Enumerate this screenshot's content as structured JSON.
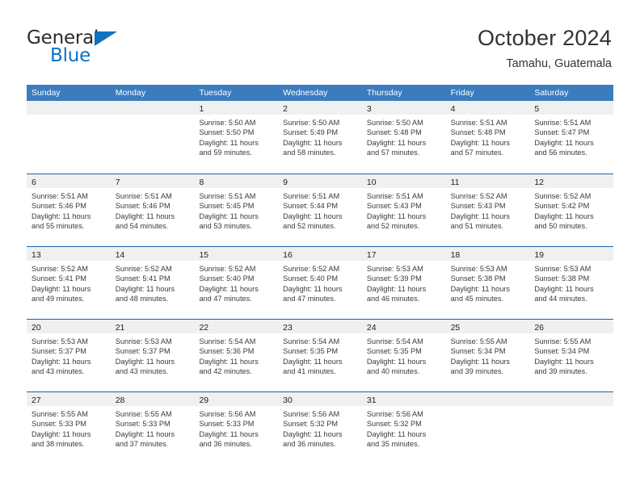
{
  "brand": {
    "name_part1": "General",
    "name_part2": "Blue"
  },
  "header": {
    "title": "October 2024",
    "subtitle": "Tamahu, Guatemala"
  },
  "colors": {
    "header_blue": "#3b7cbe",
    "separator_blue": "#1a62a8",
    "brand_blue": "#0a71c5",
    "daynum_band": "#f0f0f0"
  },
  "weekdays": [
    "Sunday",
    "Monday",
    "Tuesday",
    "Wednesday",
    "Thursday",
    "Friday",
    "Saturday"
  ],
  "weeks": [
    [
      {
        "empty": true
      },
      {
        "empty": true
      },
      {
        "day": "1",
        "sunrise": "Sunrise: 5:50 AM",
        "sunset": "Sunset: 5:50 PM",
        "daylight1": "Daylight: 11 hours",
        "daylight2": "and 59 minutes."
      },
      {
        "day": "2",
        "sunrise": "Sunrise: 5:50 AM",
        "sunset": "Sunset: 5:49 PM",
        "daylight1": "Daylight: 11 hours",
        "daylight2": "and 58 minutes."
      },
      {
        "day": "3",
        "sunrise": "Sunrise: 5:50 AM",
        "sunset": "Sunset: 5:48 PM",
        "daylight1": "Daylight: 11 hours",
        "daylight2": "and 57 minutes."
      },
      {
        "day": "4",
        "sunrise": "Sunrise: 5:51 AM",
        "sunset": "Sunset: 5:48 PM",
        "daylight1": "Daylight: 11 hours",
        "daylight2": "and 57 minutes."
      },
      {
        "day": "5",
        "sunrise": "Sunrise: 5:51 AM",
        "sunset": "Sunset: 5:47 PM",
        "daylight1": "Daylight: 11 hours",
        "daylight2": "and 56 minutes."
      }
    ],
    [
      {
        "day": "6",
        "sunrise": "Sunrise: 5:51 AM",
        "sunset": "Sunset: 5:46 PM",
        "daylight1": "Daylight: 11 hours",
        "daylight2": "and 55 minutes."
      },
      {
        "day": "7",
        "sunrise": "Sunrise: 5:51 AM",
        "sunset": "Sunset: 5:46 PM",
        "daylight1": "Daylight: 11 hours",
        "daylight2": "and 54 minutes."
      },
      {
        "day": "8",
        "sunrise": "Sunrise: 5:51 AM",
        "sunset": "Sunset: 5:45 PM",
        "daylight1": "Daylight: 11 hours",
        "daylight2": "and 53 minutes."
      },
      {
        "day": "9",
        "sunrise": "Sunrise: 5:51 AM",
        "sunset": "Sunset: 5:44 PM",
        "daylight1": "Daylight: 11 hours",
        "daylight2": "and 52 minutes."
      },
      {
        "day": "10",
        "sunrise": "Sunrise: 5:51 AM",
        "sunset": "Sunset: 5:43 PM",
        "daylight1": "Daylight: 11 hours",
        "daylight2": "and 52 minutes."
      },
      {
        "day": "11",
        "sunrise": "Sunrise: 5:52 AM",
        "sunset": "Sunset: 5:43 PM",
        "daylight1": "Daylight: 11 hours",
        "daylight2": "and 51 minutes."
      },
      {
        "day": "12",
        "sunrise": "Sunrise: 5:52 AM",
        "sunset": "Sunset: 5:42 PM",
        "daylight1": "Daylight: 11 hours",
        "daylight2": "and 50 minutes."
      }
    ],
    [
      {
        "day": "13",
        "sunrise": "Sunrise: 5:52 AM",
        "sunset": "Sunset: 5:41 PM",
        "daylight1": "Daylight: 11 hours",
        "daylight2": "and 49 minutes."
      },
      {
        "day": "14",
        "sunrise": "Sunrise: 5:52 AM",
        "sunset": "Sunset: 5:41 PM",
        "daylight1": "Daylight: 11 hours",
        "daylight2": "and 48 minutes."
      },
      {
        "day": "15",
        "sunrise": "Sunrise: 5:52 AM",
        "sunset": "Sunset: 5:40 PM",
        "daylight1": "Daylight: 11 hours",
        "daylight2": "and 47 minutes."
      },
      {
        "day": "16",
        "sunrise": "Sunrise: 5:52 AM",
        "sunset": "Sunset: 5:40 PM",
        "daylight1": "Daylight: 11 hours",
        "daylight2": "and 47 minutes."
      },
      {
        "day": "17",
        "sunrise": "Sunrise: 5:53 AM",
        "sunset": "Sunset: 5:39 PM",
        "daylight1": "Daylight: 11 hours",
        "daylight2": "and 46 minutes."
      },
      {
        "day": "18",
        "sunrise": "Sunrise: 5:53 AM",
        "sunset": "Sunset: 5:38 PM",
        "daylight1": "Daylight: 11 hours",
        "daylight2": "and 45 minutes."
      },
      {
        "day": "19",
        "sunrise": "Sunrise: 5:53 AM",
        "sunset": "Sunset: 5:38 PM",
        "daylight1": "Daylight: 11 hours",
        "daylight2": "and 44 minutes."
      }
    ],
    [
      {
        "day": "20",
        "sunrise": "Sunrise: 5:53 AM",
        "sunset": "Sunset: 5:37 PM",
        "daylight1": "Daylight: 11 hours",
        "daylight2": "and 43 minutes."
      },
      {
        "day": "21",
        "sunrise": "Sunrise: 5:53 AM",
        "sunset": "Sunset: 5:37 PM",
        "daylight1": "Daylight: 11 hours",
        "daylight2": "and 43 minutes."
      },
      {
        "day": "22",
        "sunrise": "Sunrise: 5:54 AM",
        "sunset": "Sunset: 5:36 PM",
        "daylight1": "Daylight: 11 hours",
        "daylight2": "and 42 minutes."
      },
      {
        "day": "23",
        "sunrise": "Sunrise: 5:54 AM",
        "sunset": "Sunset: 5:35 PM",
        "daylight1": "Daylight: 11 hours",
        "daylight2": "and 41 minutes."
      },
      {
        "day": "24",
        "sunrise": "Sunrise: 5:54 AM",
        "sunset": "Sunset: 5:35 PM",
        "daylight1": "Daylight: 11 hours",
        "daylight2": "and 40 minutes."
      },
      {
        "day": "25",
        "sunrise": "Sunrise: 5:55 AM",
        "sunset": "Sunset: 5:34 PM",
        "daylight1": "Daylight: 11 hours",
        "daylight2": "and 39 minutes."
      },
      {
        "day": "26",
        "sunrise": "Sunrise: 5:55 AM",
        "sunset": "Sunset: 5:34 PM",
        "daylight1": "Daylight: 11 hours",
        "daylight2": "and 39 minutes."
      }
    ],
    [
      {
        "day": "27",
        "sunrise": "Sunrise: 5:55 AM",
        "sunset": "Sunset: 5:33 PM",
        "daylight1": "Daylight: 11 hours",
        "daylight2": "and 38 minutes."
      },
      {
        "day": "28",
        "sunrise": "Sunrise: 5:55 AM",
        "sunset": "Sunset: 5:33 PM",
        "daylight1": "Daylight: 11 hours",
        "daylight2": "and 37 minutes."
      },
      {
        "day": "29",
        "sunrise": "Sunrise: 5:56 AM",
        "sunset": "Sunset: 5:33 PM",
        "daylight1": "Daylight: 11 hours",
        "daylight2": "and 36 minutes."
      },
      {
        "day": "30",
        "sunrise": "Sunrise: 5:56 AM",
        "sunset": "Sunset: 5:32 PM",
        "daylight1": "Daylight: 11 hours",
        "daylight2": "and 36 minutes."
      },
      {
        "day": "31",
        "sunrise": "Sunrise: 5:56 AM",
        "sunset": "Sunset: 5:32 PM",
        "daylight1": "Daylight: 11 hours",
        "daylight2": "and 35 minutes."
      },
      {
        "empty": true
      },
      {
        "empty": true
      }
    ]
  ]
}
